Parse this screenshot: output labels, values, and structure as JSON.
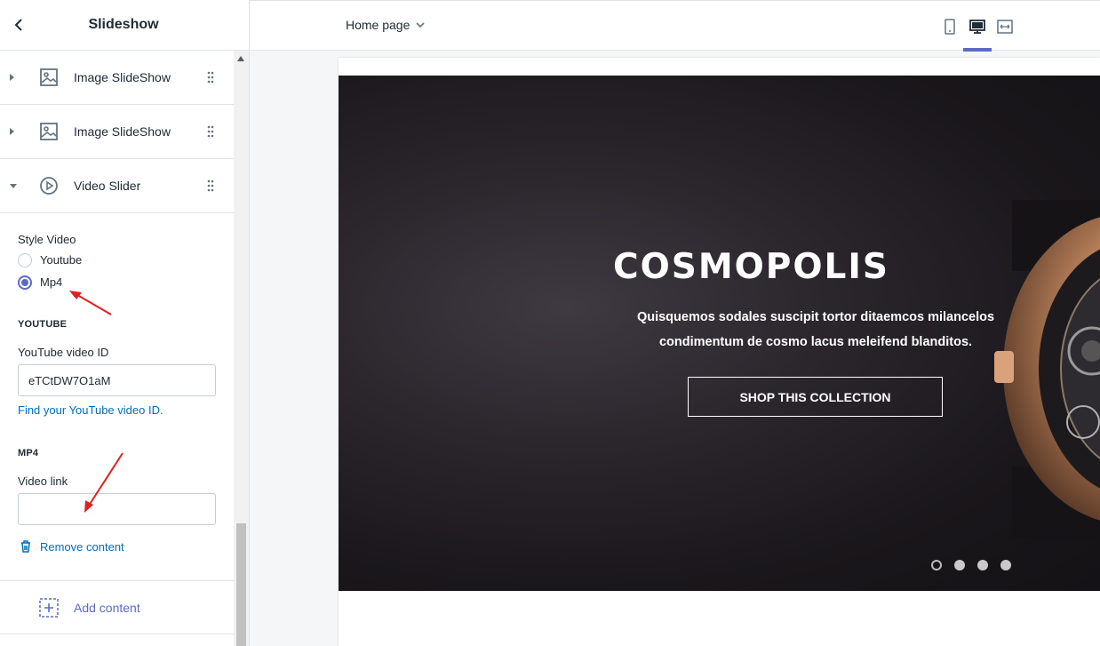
{
  "sidebar": {
    "title": "Slideshow",
    "blocks": [
      {
        "label": "Image SlideShow",
        "icon": "image-icon",
        "expanded": false
      },
      {
        "label": "Image SlideShow",
        "icon": "image-icon",
        "expanded": false
      },
      {
        "label": "Video Slider",
        "icon": "play-circle-icon",
        "expanded": true
      }
    ],
    "settings": {
      "style_label": "Style Video",
      "options": [
        "Youtube",
        "Mp4"
      ],
      "selected": "Mp4",
      "youtube_heading": "YOUTUBE",
      "youtube_id_label": "YouTube video ID",
      "youtube_id_value": "eTCtDW7O1aM",
      "youtube_help_link": "Find your YouTube video ID.",
      "mp4_heading": "MP4",
      "video_link_label": "Video link",
      "video_link_value": "",
      "remove_label": "Remove content"
    },
    "add_content_label": "Add content"
  },
  "topbar": {
    "page_select": "Home page",
    "devices": [
      "mobile-icon",
      "desktop-icon",
      "full-width-icon"
    ],
    "active_device": "desktop-icon"
  },
  "preview": {
    "title": "COSMOPOLIS",
    "text_line1": "Quisquemos sodales suscipit tortor ditaemcos milancelos",
    "text_line2": "condimentum de cosmo lacus meleifend blanditos.",
    "button_label": "SHOP THIS COLLECTION",
    "slide_count": 4,
    "active_slide": 1
  },
  "colors": {
    "accent": "#5c6ac4",
    "link": "#006fbb",
    "annotation_arrow": "#e02020"
  }
}
